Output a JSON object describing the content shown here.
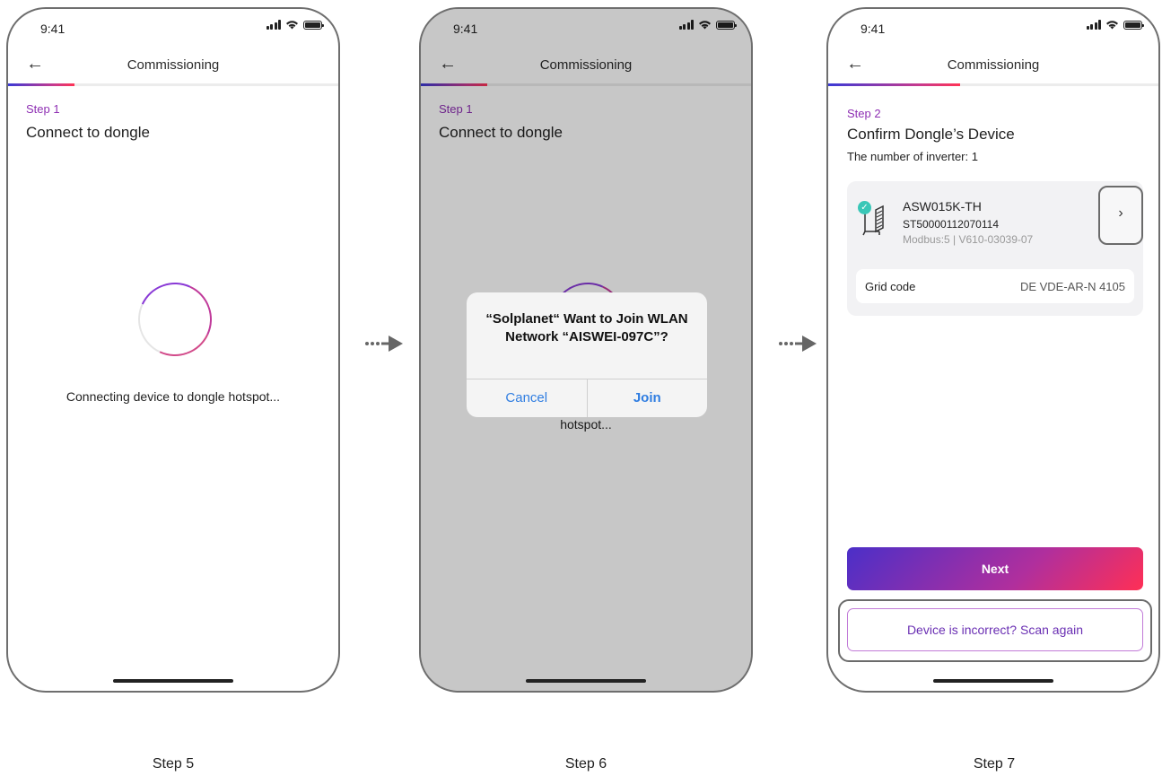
{
  "screens": [
    {
      "time": "9:41",
      "nav_title": "Commissioning",
      "progress_fraction": 0.2,
      "step_label": "Step 1",
      "step_title": "Connect to dongle",
      "status_text": "Connecting device to dongle hotspot...",
      "caption": "Step 5"
    },
    {
      "time": "9:41",
      "nav_title": "Commissioning",
      "progress_fraction": 0.2,
      "step_label": "Step 1",
      "step_title": "Connect to dongle",
      "status_text": "hotspot...",
      "alert": {
        "message": "“Solplanet“ Want to Join WLAN Network “AISWEI-097C”?",
        "cancel_label": "Cancel",
        "join_label": "Join"
      },
      "caption": "Step 6"
    },
    {
      "time": "9:41",
      "nav_title": "Commissioning",
      "progress_fraction": 0.4,
      "step_label": "Step 2",
      "step_title": "Confirm Dongle’s Device",
      "inverter_count_text": "The number of inverter: 1",
      "device": {
        "model": "ASW015K-TH",
        "serial": "ST50000112070114",
        "info": "Modbus:5 | V610-03039-07",
        "grid_code_label": "Grid code",
        "grid_code_value": "DE VDE-AR-N 4105"
      },
      "next_label": "Next",
      "scan_again_label": "Device is incorrect? Scan again",
      "caption": "Step 7"
    }
  ],
  "colors": {
    "accent_purple": "#8e2fb3",
    "ios_blue": "#2f7de1",
    "check_teal": "#39c7b7"
  }
}
